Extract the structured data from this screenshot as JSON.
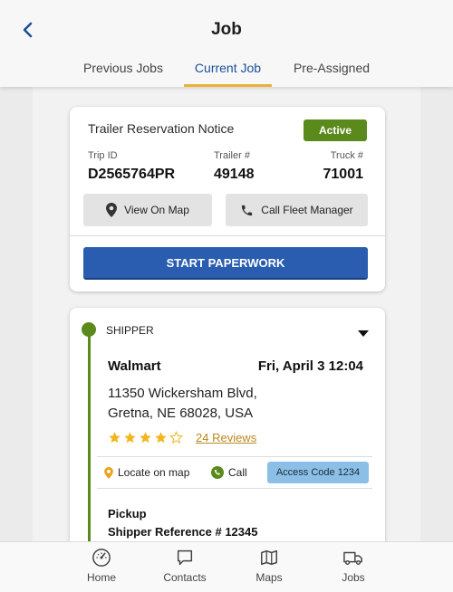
{
  "header": {
    "title": "Job",
    "back_icon": "chevron-left-icon",
    "tabs": [
      {
        "label": "Previous Jobs",
        "active": false
      },
      {
        "label": "Current Job",
        "active": true
      },
      {
        "label": "Pre-Assigned",
        "active": false
      }
    ]
  },
  "trip_card": {
    "title": "Trailer Reservation Notice",
    "status": "Active",
    "trip_id_label": "Trip ID",
    "trip_id": "D2565764PR",
    "trailer_label": "Trailer #",
    "trailer": "49148",
    "truck_label": "Truck #",
    "truck": "71001",
    "view_map_label": "View On Map",
    "call_fleet_label": "Call Fleet Manager",
    "start_label": "START PAPERWORK"
  },
  "shipper_card": {
    "type_label": "SHIPPER",
    "name": "Walmart",
    "datetime": "Fri, April 3 12:04",
    "address_line1": "11350 Wickersham Blvd,",
    "address_line2": "Gretna, NE 68028, USA",
    "rating": 4,
    "rating_max": 5,
    "reviews_label": "24 Reviews",
    "locate_label": "Locate on map",
    "call_label": "Call",
    "access_code_label": "Access Code 1234",
    "pickup_label": "Pickup",
    "shipper_ref": "Shipper Reference # 12345"
  },
  "bottom_nav": [
    {
      "label": "Home",
      "icon": "speedometer-icon"
    },
    {
      "label": "Contacts",
      "icon": "chat-bubble-icon"
    },
    {
      "label": "Maps",
      "icon": "map-icon"
    },
    {
      "label": "Jobs",
      "icon": "truck-icon"
    }
  ],
  "colors": {
    "accent_blue": "#2a5db0",
    "active_tab": "#1e4f95",
    "tab_underline": "#e9b33a",
    "status_green": "#5a8a1b",
    "star_gold": "#f2b51b",
    "access_blue": "#8bbfe6"
  }
}
